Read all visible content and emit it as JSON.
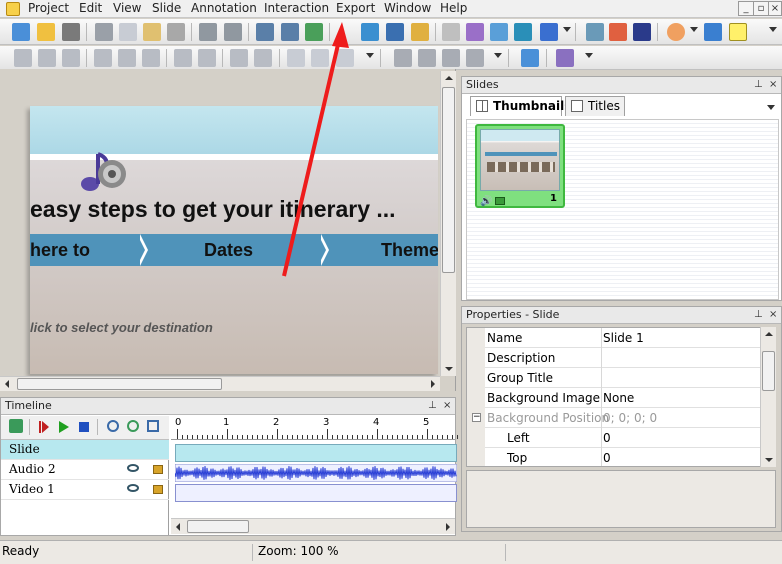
{
  "menu": {
    "items": [
      "Project",
      "Edit",
      "View",
      "Slide",
      "Annotation",
      "Interaction",
      "Export",
      "Window",
      "Help"
    ]
  },
  "window_controls": {
    "minimize": "_",
    "restore": "▫",
    "close": "×"
  },
  "slide": {
    "title": "easy steps to get your itinerary ...",
    "tabs": [
      "here to",
      "Dates",
      "Theme"
    ],
    "hint": "lick to select your destination"
  },
  "slides_panel": {
    "title": "Slides",
    "tabs": [
      "Thumbnails",
      "Titles"
    ],
    "thumbnail_number": "1"
  },
  "properties": {
    "title": "Properties - Slide",
    "rows": [
      {
        "name": "Name",
        "value": "Slide 1"
      },
      {
        "name": "Description",
        "value": ""
      },
      {
        "name": "Group Title",
        "value": ""
      },
      {
        "name": "Background Image",
        "value": "None"
      },
      {
        "name": "Background Position",
        "value": "0; 0; 0; 0"
      },
      {
        "name": "Left",
        "value": "0"
      },
      {
        "name": "Top",
        "value": "0"
      }
    ],
    "expander_symbol": "−"
  },
  "timeline": {
    "title": "Timeline",
    "rows": [
      "Slide",
      "Audio 2",
      "Video 1"
    ],
    "ruler_labels": [
      "0",
      "1",
      "2",
      "3",
      "4",
      "5"
    ]
  },
  "statusbar": {
    "status": "Ready",
    "zoom": "Zoom: 100 %"
  },
  "colors": {
    "accent_arrow": "#ee1c1c",
    "slide_tab_bar": "#4f93ba",
    "selected_thumbnail": "#7fe07f",
    "selected_row": "#b7e8ef",
    "audio_wave": "#2a3fd6"
  }
}
